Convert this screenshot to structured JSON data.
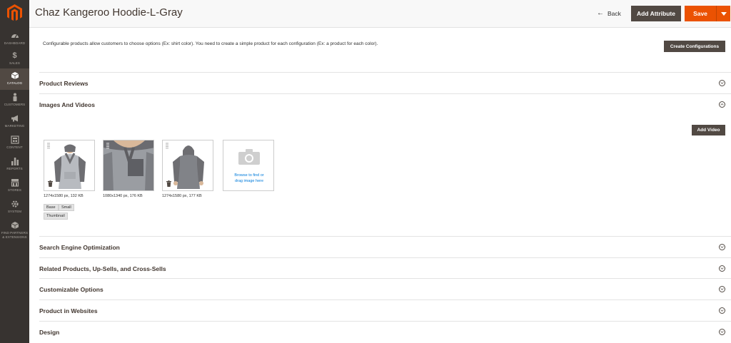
{
  "header": {
    "title": "Chaz Kangeroo Hoodie-L-Gray",
    "back_label": "Back",
    "add_attribute_label": "Add Attribute",
    "save_label": "Save"
  },
  "sidebar": {
    "items": [
      {
        "label": "DASHBOARD",
        "icon": "dashboard-icon"
      },
      {
        "label": "SALES",
        "icon": "dollar-icon"
      },
      {
        "label": "CATALOG",
        "icon": "cube-icon",
        "active": true
      },
      {
        "label": "CUSTOMERS",
        "icon": "person-icon"
      },
      {
        "label": "MARKETING",
        "icon": "megaphone-icon"
      },
      {
        "label": "CONTENT",
        "icon": "layout-icon"
      },
      {
        "label": "REPORTS",
        "icon": "bar-chart-icon"
      },
      {
        "label": "STORES",
        "icon": "store-icon"
      },
      {
        "label": "SYSTEM",
        "icon": "gear-icon"
      },
      {
        "label": "FIND PARTNERS",
        "label2": "& EXTENSIONS",
        "icon": "box-icon"
      }
    ]
  },
  "config": {
    "note": "Configurable products allow customers to choose options (Ex: shirt color). You need to create a simple product for each configuration (Ex: a product for each color).",
    "create_label": "Create Configurations"
  },
  "sections": {
    "reviews": "Product Reviews",
    "images": "Images And Videos",
    "seo": "Search Engine Optimization",
    "related": "Related Products, Up-Sells, and Cross-Sells",
    "options": "Customizable Options",
    "websites": "Product in Websites",
    "design": "Design"
  },
  "images": {
    "add_video_label": "Add Video",
    "items": [
      {
        "meta": "1274x1580 px, 132 KB",
        "roles": [
          "Base",
          "Small",
          "Thumbnail"
        ]
      },
      {
        "meta": "1080x1340 px, 176 KB",
        "roles": []
      },
      {
        "meta": "1274x1580 px, 177 KB",
        "roles": []
      }
    ],
    "upload_line1": "Browse to find or",
    "upload_line2": "drag image here"
  },
  "colors": {
    "sidebar_bg": "#373330",
    "accent": "#eb5202",
    "dark_button": "#514943",
    "link": "#007bdb"
  }
}
